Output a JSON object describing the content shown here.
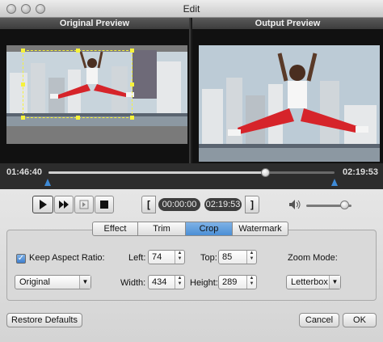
{
  "window": {
    "title": "Edit"
  },
  "preview": {
    "original_label": "Original Preview",
    "output_label": "Output Preview"
  },
  "timeline": {
    "start_time": "01:46:40",
    "end_time": "02:19:53",
    "position_fraction": 0.76
  },
  "playback": {
    "clip_start": "00:00:00",
    "clip_end": "02:19:53",
    "volume_fraction": 0.85
  },
  "tabs": [
    "Effect",
    "Trim",
    "Crop",
    "Watermark"
  ],
  "active_tab": "Crop",
  "crop": {
    "keep_aspect_label": "Keep Aspect Ratio:",
    "keep_aspect_checked": true,
    "left_label": "Left:",
    "left_value": "74",
    "top_label": "Top:",
    "top_value": "85",
    "width_label": "Width:",
    "width_value": "434",
    "height_label": "Height:",
    "height_value": "289",
    "aspect_select": "Original",
    "zoom_mode_label": "Zoom Mode:",
    "zoom_mode_value": "Letterbox"
  },
  "buttons": {
    "restore": "Restore Defaults",
    "cancel": "Cancel",
    "ok": "OK"
  },
  "colors": {
    "accent": "#4b8fd6",
    "crop_box": "#f6f23b",
    "shirt": "#ffffff",
    "pants": "#d6242a"
  }
}
